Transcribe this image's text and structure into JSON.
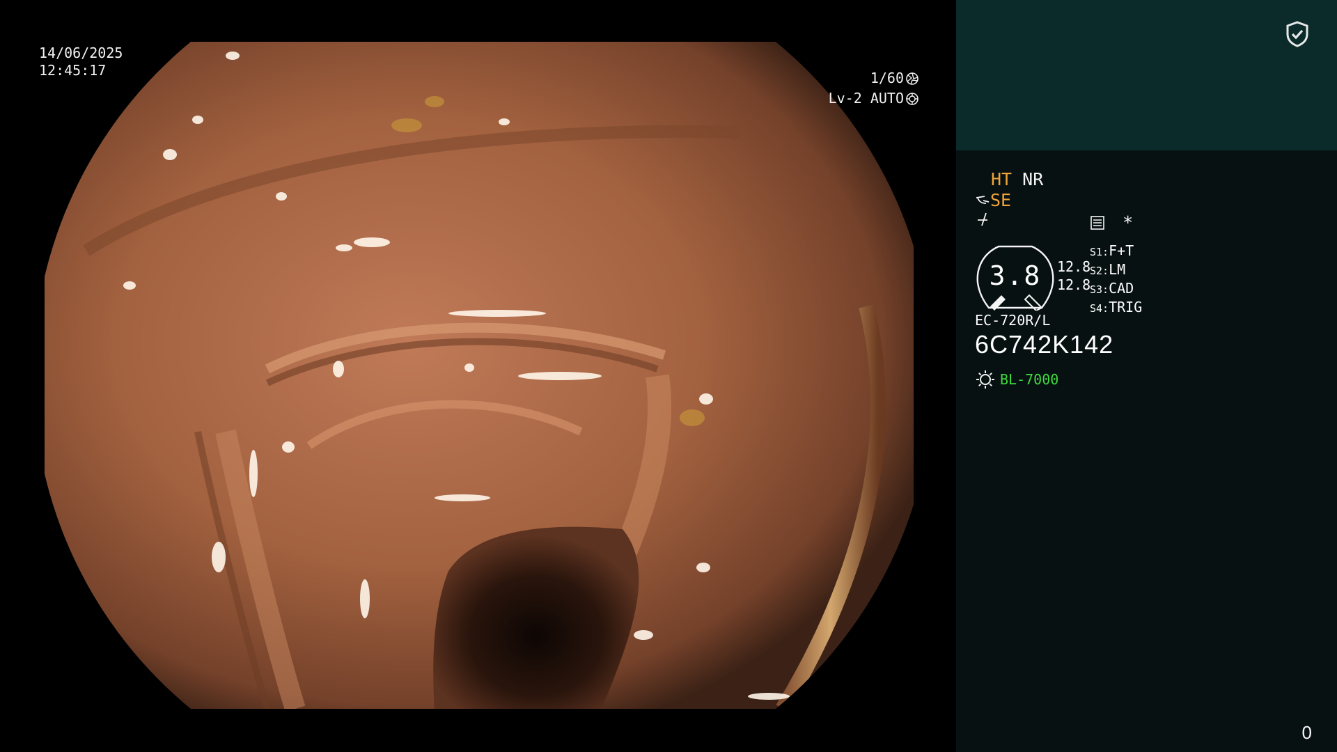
{
  "overlay": {
    "date": "14/06/2025",
    "time": "12:45:17",
    "shutter": "1/60",
    "iris": "Lv-2 AUTO"
  },
  "panel": {
    "ht_label": "HT",
    "nr_label": "NR",
    "se_label": "SE",
    "asterisk": "*",
    "gauge_value": "3.8",
    "gauge_side_top": "12.8",
    "gauge_side_bottom": "12.8",
    "slots": [
      {
        "key": "S1:",
        "value": "F+T"
      },
      {
        "key": "S2:",
        "value": "LM"
      },
      {
        "key": "S3:",
        "value": "CAD"
      },
      {
        "key": "S4:",
        "value": "TRIG"
      }
    ],
    "scope_model": "EC-720R/L",
    "scope_serial": "6C742K142",
    "light_source": "BL-7000",
    "page_counter": "0"
  },
  "colors": {
    "panel_top": "#0b2a2a",
    "panel_bg": "#081112",
    "accent_orange": "#f0a43a",
    "accent_green": "#3ddc3d",
    "tissue": "#a8684a"
  },
  "icons": [
    "shutter-icon",
    "iris-icon",
    "shield-check-icon",
    "scope-icon",
    "freeze-icon",
    "settings-list-icon",
    "light-source-icon"
  ]
}
